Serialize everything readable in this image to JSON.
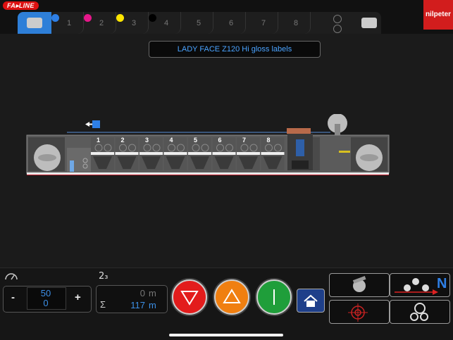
{
  "brand": {
    "left_logo": "FA▸LINE",
    "right_logo": "nilpeter"
  },
  "tabs": [
    {
      "num": "1",
      "dot_color": "#2e7fe6"
    },
    {
      "num": "2",
      "dot_color": "#e6178a"
    },
    {
      "num": "3",
      "dot_color": "#ffe600"
    },
    {
      "num": "4",
      "dot_color": "#000000"
    },
    {
      "num": "5"
    },
    {
      "num": "6"
    },
    {
      "num": "7"
    },
    {
      "num": "8"
    }
  ],
  "job_title": "LADY FACE Z120 Hi gloss labels",
  "machine": {
    "stations": [
      "1",
      "2",
      "3",
      "4",
      "5",
      "6",
      "7",
      "8"
    ]
  },
  "speed": {
    "target": "50",
    "actual": "0",
    "minus": "-",
    "plus": "+"
  },
  "counter": {
    "icon": "2₃",
    "current": "0",
    "current_unit": "m",
    "sum_symbol": "Σ",
    "total": "117",
    "total_unit": "m"
  },
  "colors": {
    "accent": "#2e7fd8",
    "brand_red": "#d21d1d",
    "stop": "#e31c1c",
    "jog": "#f07f10",
    "run": "#1f9e3a"
  },
  "icons": {
    "speed": "speedometer-icon",
    "stop": "down-triangle-icon",
    "jog": "up-triangle-icon",
    "run": "start-icon",
    "home": "home-icon",
    "settings": "wrench-gear-icon",
    "register": "crosshair-icon",
    "web_path": "web-path-icon",
    "rolls": "rolls-icon"
  }
}
